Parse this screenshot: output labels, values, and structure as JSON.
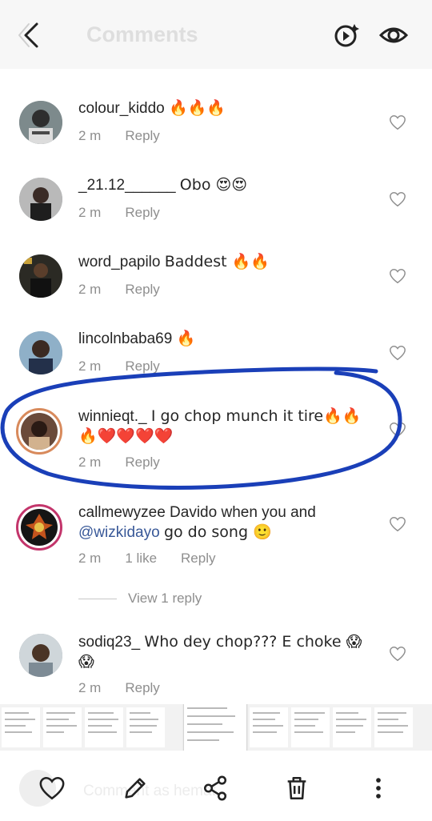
{
  "header": {
    "title": "Comments",
    "back_icon": "arrow-left-icon",
    "effects_icon": "sparkle-play-icon",
    "view_icon": "eye-icon"
  },
  "comments": [
    {
      "username": "colour_kiddo",
      "text": "🔥🔥🔥",
      "time": "2 m",
      "reply": "Reply"
    },
    {
      "username": "_21.12______",
      "text": "Obo 😍😍",
      "time": "2 m",
      "reply": "Reply"
    },
    {
      "username": "word_papilo",
      "text": "Baddest 🔥🔥",
      "time": "2 m",
      "reply": "Reply"
    },
    {
      "username": "lincolnbaba69",
      "text": "🔥",
      "time": "2 m",
      "reply": "Reply"
    },
    {
      "username": "winnieqt._",
      "text": "I go chop munch it tire🔥🔥🔥❤️❤️❤️❤️",
      "time": "2 m",
      "reply": "Reply"
    },
    {
      "username": "callmewyzee",
      "text_before": "Davido when you and",
      "mention": "@wizkidayo",
      "text_after": "go do song 🙂",
      "time": "2 m",
      "likes": "1 like",
      "reply": "Reply"
    },
    {
      "username": "sodiq23_",
      "text": "Who dey chop??? E choke 😱😱",
      "time": "2 m",
      "reply": "Reply"
    }
  ],
  "view_replies": "View 1 reply",
  "bottom_bar": {
    "hint": "Comment as hemat...",
    "icons": [
      "heart-icon",
      "pencil-icon",
      "share-icon",
      "trash-icon",
      "more-icon"
    ]
  },
  "colors": {
    "annotation": "#1a3fb8",
    "meta": "#8e8e8e",
    "mention": "#385898"
  }
}
